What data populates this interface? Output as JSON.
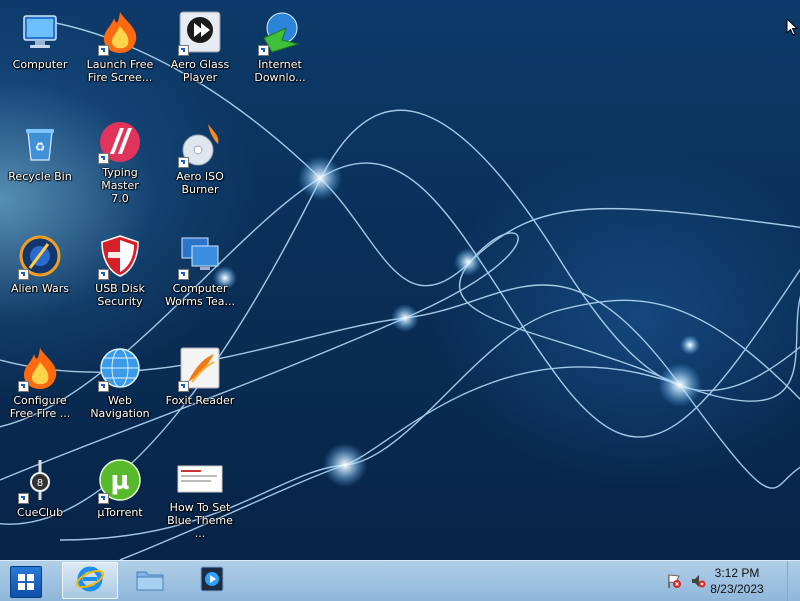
{
  "desktop": {
    "icons": [
      {
        "label": "Computer"
      },
      {
        "label": "Launch Free\nFire Scree..."
      },
      {
        "label": "Aero Glass\nPlayer"
      },
      {
        "label": "Internet\nDownlo..."
      },
      {
        "label": "Recycle Bin"
      },
      {
        "label": "Typing Master\n7.0"
      },
      {
        "label": "Aero ISO\nBurner"
      },
      {
        "label": "Alien Wars"
      },
      {
        "label": "USB Disk\nSecurity"
      },
      {
        "label": "Computer\nWorms Tea..."
      },
      {
        "label": "Configure\nFree Fire ..."
      },
      {
        "label": "Web\nNavigation"
      },
      {
        "label": "Foxit Reader"
      },
      {
        "label": "CueClub"
      },
      {
        "label": "µTorrent"
      },
      {
        "label": "How To Set\nBlue Theme ..."
      }
    ]
  },
  "taskbar": {
    "clock": {
      "time": "3:12 PM",
      "date": "8/23/2023"
    },
    "pinned": [
      "internet-explorer-icon",
      "file-explorer-icon",
      "media-player-icon"
    ]
  },
  "colors": {
    "accent": "#1b5fc1",
    "taskbar": "#b9d7f0",
    "desktop_bg": "#0b2b52"
  }
}
